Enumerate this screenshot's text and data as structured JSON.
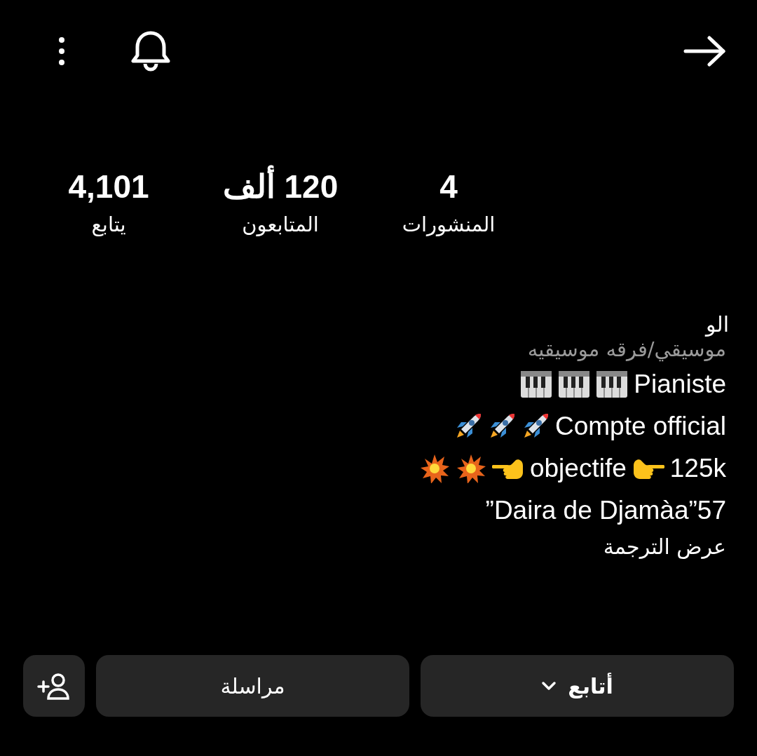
{
  "stats": [
    {
      "value": "4",
      "label": "المنشورات"
    },
    {
      "value": "120 ألف",
      "label": "المتابعون"
    },
    {
      "value": "4,101",
      "label": "يتابع"
    }
  ],
  "bio": {
    "name_fragment": "الو",
    "category": "موسيقي/فرقه موسيقيه",
    "lines": [
      {
        "items": [
          {
            "kind": "text",
            "text": "Pianiste"
          },
          {
            "kind": "piano"
          },
          {
            "kind": "piano"
          },
          {
            "kind": "piano"
          }
        ]
      },
      {
        "items": [
          {
            "kind": "text",
            "text": "Compte official"
          },
          {
            "kind": "rocket"
          },
          {
            "kind": "rocket"
          },
          {
            "kind": "rocket"
          }
        ]
      },
      {
        "items": [
          {
            "kind": "text",
            "text": "125k"
          },
          {
            "kind": "hand_right"
          },
          {
            "kind": "text",
            "text": "objectife"
          },
          {
            "kind": "hand_left"
          },
          {
            "kind": "burst"
          },
          {
            "kind": "burst"
          }
        ]
      },
      {
        "items": [
          {
            "kind": "text",
            "text": "”Daira de Djamàa”57"
          }
        ]
      }
    ],
    "translate_link": "عرض الترجمة"
  },
  "buttons": [
    {
      "label": "أتابع"
    },
    {
      "label": "مراسلة"
    }
  ]
}
